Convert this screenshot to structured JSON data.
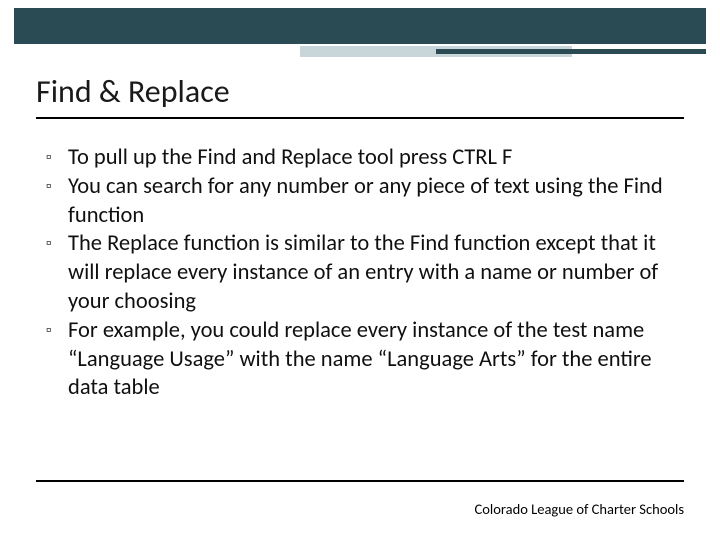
{
  "slide": {
    "title": "Find & Replace",
    "bullets": [
      "To pull up the Find and Replace tool press CTRL F",
      "You can search for any number or any piece of text using the Find function",
      "The Replace function is similar to the Find function except that it will replace every instance of an entry with a name or number of your choosing",
      "For example, you could replace every instance of the test name “Language Usage” with the name “Language Arts” for the entire data table"
    ],
    "footer": "Colorado League of Charter Schools"
  },
  "colors": {
    "accent_dark": "#2b4b54",
    "accent_light": "#c9d6d9"
  }
}
